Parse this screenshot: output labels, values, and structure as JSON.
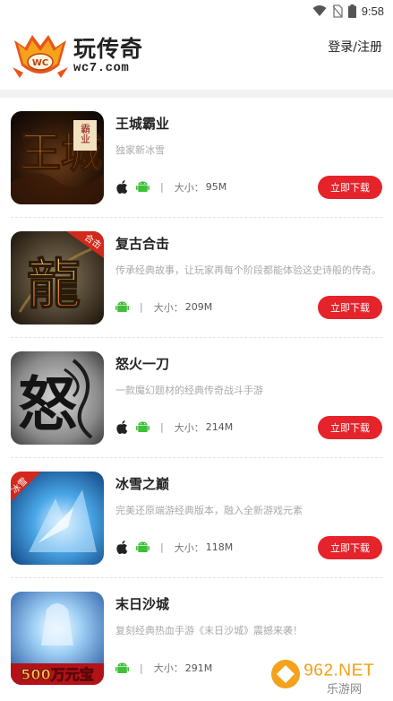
{
  "status_bar": {
    "time": "9:58"
  },
  "header": {
    "logo_cn": "玩传奇",
    "logo_en": "wc7.com",
    "login_label": "登录/注册"
  },
  "games": [
    {
      "name": "王城霸业",
      "desc": "独家新冰雪",
      "platforms": [
        "apple-icon",
        "android-icon"
      ],
      "size_label": "大小：",
      "size": "95M",
      "button": "立即下载",
      "thumb_text": "王城",
      "thumb_badge": "霸业"
    },
    {
      "name": "复古合击",
      "desc": "传承经典故事，让玩家再每个阶段都能体验这史诗般的传奇。",
      "platforms": [
        "android-icon"
      ],
      "size_label": "大小：",
      "size": "209M",
      "button": "立即下载",
      "thumb_text": "龍",
      "thumb_badge": "合击"
    },
    {
      "name": "怒火一刀",
      "desc": "一款魔幻题材的经典传奇战斗手游",
      "platforms": [
        "apple-icon",
        "android-icon"
      ],
      "size_label": "大小：",
      "size": "214M",
      "button": "立即下载",
      "thumb_text": "怒"
    },
    {
      "name": "冰雪之巅",
      "desc": "完美还原端游经典版本，融入全新游戏元素",
      "platforms": [
        "apple-icon",
        "android-icon"
      ],
      "size_label": "大小：",
      "size": "118M",
      "button": "立即下载",
      "thumb_badge": "冰雪"
    },
    {
      "name": "末日沙城",
      "desc": "复刻经典热血手游《末日沙城》震撼来袭！",
      "platforms": [
        "android-icon"
      ],
      "size_label": "大小：",
      "size": "291M",
      "button": "立即下载",
      "thumb_text": "500万元宝"
    }
  ],
  "watermark": {
    "brand": "962.NET",
    "sub": "乐游网"
  },
  "colors": {
    "accent": "#e5232b",
    "text": "#222222",
    "muted": "#aaaaaa"
  }
}
